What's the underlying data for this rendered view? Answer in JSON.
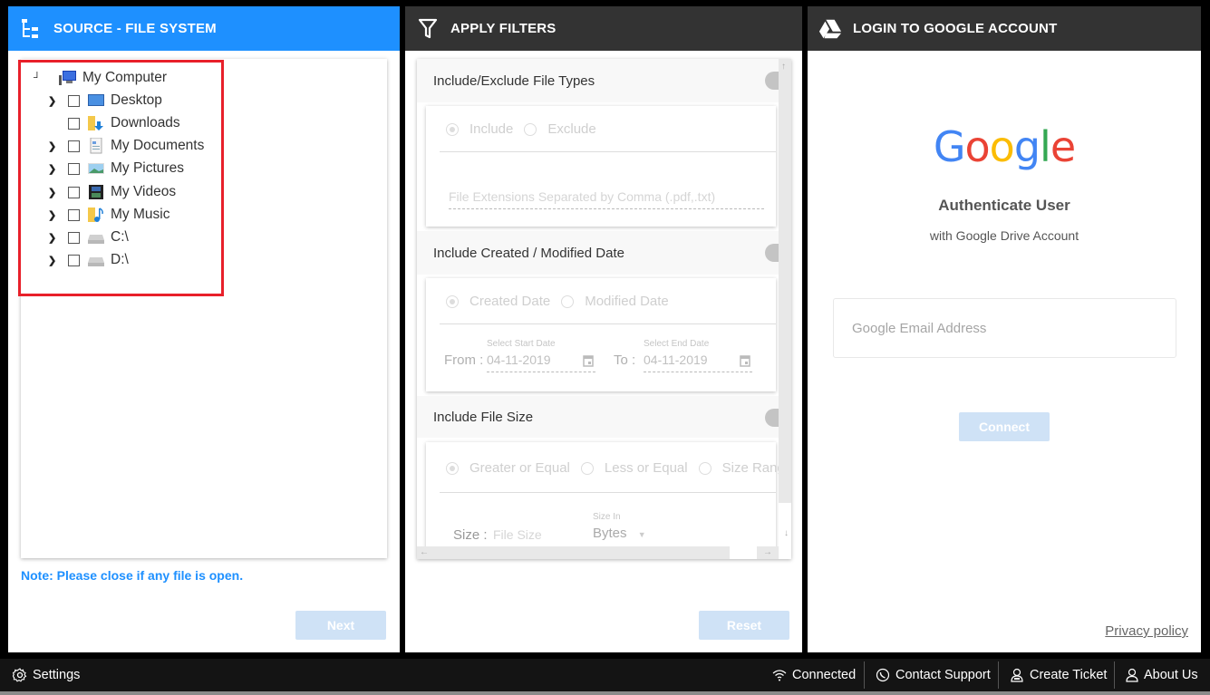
{
  "source_panel": {
    "title": "SOURCE - FILE SYSTEM",
    "accent_color": "#1e90ff",
    "tree": {
      "root": {
        "label": "My Computer",
        "expanded": true,
        "icon": "computer-icon"
      },
      "children": [
        {
          "label": "Desktop",
          "icon": "desktop-icon",
          "expandable": true,
          "checked": false
        },
        {
          "label": "Downloads",
          "icon": "downloads-folder-icon",
          "expandable": false,
          "checked": false
        },
        {
          "label": "My Documents",
          "icon": "document-icon",
          "expandable": true,
          "checked": false
        },
        {
          "label": "My Pictures",
          "icon": "picture-icon",
          "expandable": true,
          "checked": false
        },
        {
          "label": "My Videos",
          "icon": "video-icon",
          "expandable": true,
          "checked": false
        },
        {
          "label": "My Music",
          "icon": "music-folder-icon",
          "expandable": true,
          "checked": false
        },
        {
          "label": "C:\\",
          "icon": "drive-icon",
          "expandable": true,
          "checked": false
        },
        {
          "label": "D:\\",
          "icon": "drive-icon",
          "expandable": true,
          "checked": false
        }
      ]
    },
    "note": "Note: Please close if any file is open.",
    "next_label": "Next"
  },
  "filters_panel": {
    "title": "APPLY FILTERS",
    "file_types": {
      "heading": "Include/Exclude File Types",
      "options": [
        "Include",
        "Exclude"
      ],
      "selected": "Include",
      "placeholder": "File Extensions Separated by Comma (.pdf,.txt)"
    },
    "date": {
      "heading": "Include Created / Modified Date",
      "options": [
        "Created Date",
        "Modified Date"
      ],
      "selected": "Created Date",
      "from_label": "From :",
      "to_label": "To :",
      "start_caption": "Select Start Date",
      "end_caption": "Select End Date",
      "start_value": "04-11-2019",
      "end_value": "04-11-2019"
    },
    "size": {
      "heading": "Include File Size",
      "options": [
        "Greater or Equal",
        "Less or Equal",
        "Size Range"
      ],
      "selected": "Greater or Equal",
      "size_label": "Size :",
      "size_placeholder": "File Size",
      "unit_caption": "Size In",
      "unit_value": "Bytes"
    },
    "reset_label": "Reset"
  },
  "google_panel": {
    "title": "LOGIN TO GOOGLE ACCOUNT",
    "logo_letters": [
      {
        "char": "G",
        "color": "#4285f4"
      },
      {
        "char": "o",
        "color": "#ea4335"
      },
      {
        "char": "o",
        "color": "#fbbc05"
      },
      {
        "char": "g",
        "color": "#4285f4"
      },
      {
        "char": "l",
        "color": "#34a853"
      },
      {
        "char": "e",
        "color": "#ea4335"
      }
    ],
    "auth_title": "Authenticate User",
    "auth_subtitle": "with Google Drive Account",
    "email_placeholder": "Google Email Address",
    "connect_label": "Connect",
    "privacy_label": "Privacy policy"
  },
  "statusbar": {
    "settings": "Settings",
    "connected": "Connected",
    "contact_support": "Contact Support",
    "create_ticket": "Create Ticket",
    "about_us": "About Us"
  }
}
